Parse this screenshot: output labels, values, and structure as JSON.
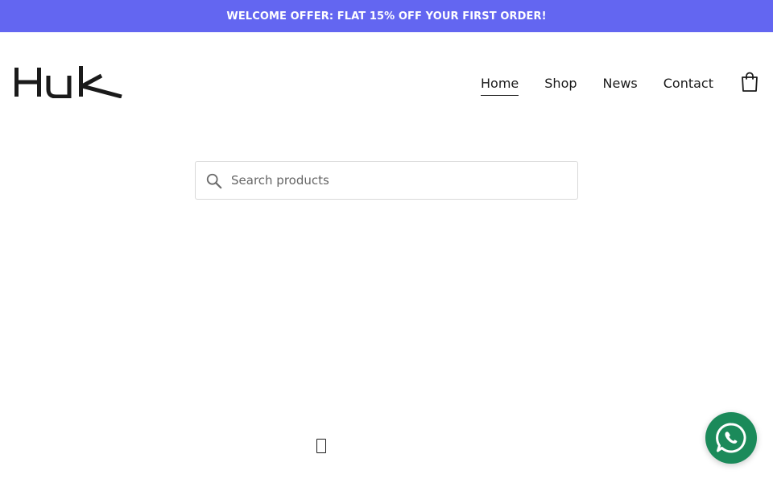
{
  "colors": {
    "promo_bg": "#6366f1",
    "promo_text": "#ffffff",
    "text": "#1a1a1a",
    "search_border": "#d9d9d9",
    "whatsapp": "#1b8a5a"
  },
  "promo": {
    "text": "WELCOME OFFER: FLAT 15% OFF YOUR FIRST ORDER!"
  },
  "header": {
    "logo_text": "Huk",
    "nav": [
      {
        "label": "Home",
        "active": true
      },
      {
        "label": "Shop",
        "active": false
      },
      {
        "label": "News",
        "active": false
      },
      {
        "label": "Contact",
        "active": false
      }
    ],
    "cart_icon": "shopping-bag-icon"
  },
  "search": {
    "placeholder": "Search products",
    "value": "",
    "icon": "search-icon"
  },
  "floating": {
    "whatsapp_icon": "whatsapp-icon"
  }
}
